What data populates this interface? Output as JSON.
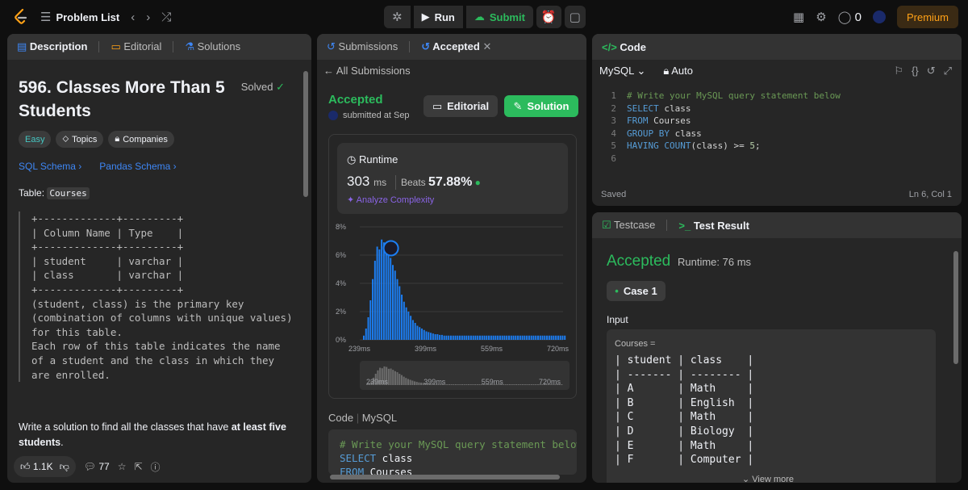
{
  "topbar": {
    "problem_list": "Problem List",
    "run": "Run",
    "submit": "Submit",
    "streak_count": "0",
    "premium": "Premium"
  },
  "description_panel": {
    "tabs": [
      "Description",
      "Editorial",
      "Solutions"
    ],
    "title": "596. Classes More Than 5 Students",
    "solved": "Solved",
    "tags": [
      "Easy",
      "Topics",
      "Companies"
    ],
    "schema_links": [
      "SQL Schema",
      "Pandas Schema"
    ],
    "table_label": "Table:",
    "table_name": "Courses",
    "schema_text": "+-------------+---------+\n| Column Name | Type    |\n+-------------+---------+\n| student     | varchar |\n| class       | varchar |\n+-------------+---------+\n(student, class) is the primary key\n(combination of columns with unique values)\nfor this table.\nEach row of this table indicates the name\nof a student and the class in which they\nare enrolled.",
    "problem_text_prefix": "Write a solution to find all the classes that have ",
    "problem_text_bold": "at least five students",
    "problem_text_suffix": ".",
    "likes": "1.1K",
    "comments": "77"
  },
  "submission_panel": {
    "tabs": [
      "Submissions",
      "Accepted"
    ],
    "all_submissions": "All Submissions",
    "status": "Accepted",
    "submitted_at": "submitted at Sep",
    "editorial_btn": "Editorial",
    "solution_btn": "Solution",
    "runtime_label": "Runtime",
    "runtime_value": "303",
    "runtime_unit": "ms",
    "beats_label": "Beats",
    "beats_value": "57.88%",
    "analyze": "Analyze Complexity",
    "code_label": "Code",
    "code_lang": "MySQL",
    "code_snippet": "# Write your MySQL query statement below\nSELECT class\nFROM Courses"
  },
  "chart_data": {
    "type": "bar",
    "title": "",
    "xlabel": "",
    "ylabel": "",
    "y_ticks": [
      "8%",
      "6%",
      "4%",
      "2%",
      "0%"
    ],
    "x_ticks": [
      "239ms",
      "399ms",
      "559ms",
      "720ms"
    ],
    "ylim": [
      0,
      8
    ],
    "xlim": [
      239,
      720
    ],
    "highlighted_x": 303,
    "values": [
      0.3,
      0.8,
      1.6,
      2.8,
      4.3,
      5.6,
      6.6,
      6.4,
      7.1,
      6.9,
      6.2,
      6.3,
      5.8,
      5.3,
      4.9,
      4.3,
      3.8,
      3.2,
      2.7,
      2.3,
      2.0,
      1.7,
      1.4,
      1.2,
      1.0,
      0.9,
      0.8,
      0.7,
      0.6,
      0.55,
      0.5,
      0.45,
      0.4,
      0.4,
      0.35,
      0.35,
      0.3,
      0.3,
      0.3,
      0.3,
      0.3,
      0.3,
      0.3,
      0.3,
      0.3,
      0.3,
      0.3,
      0.3,
      0.3,
      0.3,
      0.3,
      0.3,
      0.3,
      0.3,
      0.3,
      0.3,
      0.3,
      0.3,
      0.3,
      0.3,
      0.3,
      0.3,
      0.3,
      0.3,
      0.3,
      0.3,
      0.3,
      0.3,
      0.3,
      0.3,
      0.3,
      0.3,
      0.3,
      0.3,
      0.3,
      0.3,
      0.3,
      0.3,
      0.3,
      0.3,
      0.3,
      0.3,
      0.3,
      0.3,
      0.3,
      0.3,
      0.3,
      0.3,
      0.3,
      0.3,
      0.3
    ],
    "bar_color": "#1c7ef3"
  },
  "code_panel": {
    "title": "Code",
    "lang": "MySQL",
    "mode": "Auto",
    "lines": [
      {
        "n": "1",
        "parts": [
          {
            "c": "cm",
            "t": "# Write your MySQL query statement below"
          }
        ]
      },
      {
        "n": "2",
        "parts": [
          {
            "c": "kw",
            "t": "SELECT"
          },
          {
            "c": "tx",
            "t": " class"
          }
        ]
      },
      {
        "n": "3",
        "parts": [
          {
            "c": "kw",
            "t": "FROM"
          },
          {
            "c": "tx",
            "t": " Courses"
          }
        ]
      },
      {
        "n": "4",
        "parts": [
          {
            "c": "kw",
            "t": "GROUP BY"
          },
          {
            "c": "tx",
            "t": " class"
          }
        ]
      },
      {
        "n": "5",
        "parts": [
          {
            "c": "kw",
            "t": "HAVING COUNT"
          },
          {
            "c": "tx",
            "t": "(class) "
          },
          {
            "c": "op",
            "t": ">="
          },
          {
            "c": "tx",
            "t": " "
          },
          {
            "c": "nm",
            "t": "5"
          },
          {
            "c": "tx",
            "t": ";"
          }
        ]
      },
      {
        "n": "6",
        "parts": []
      }
    ],
    "saved": "Saved",
    "cursor": "Ln 6, Col 1"
  },
  "test_panel": {
    "tabs": [
      "Testcase",
      "Test Result"
    ],
    "status": "Accepted",
    "runtime": "Runtime: 76 ms",
    "case": "Case 1",
    "input_label": "Input",
    "courses_label": "Courses =",
    "table_text": "| student | class    |\n| ------- | -------- |\n| A       | Math     |\n| B       | English  |\n| C       | Math     |\n| D       | Biology  |\n| E       | Math     |\n| F       | Computer |",
    "view_more": "View more"
  },
  "colors": {
    "accent_green": "#2cbb5d",
    "accent_orange": "#ffa116",
    "link_blue": "#3e87f6"
  }
}
